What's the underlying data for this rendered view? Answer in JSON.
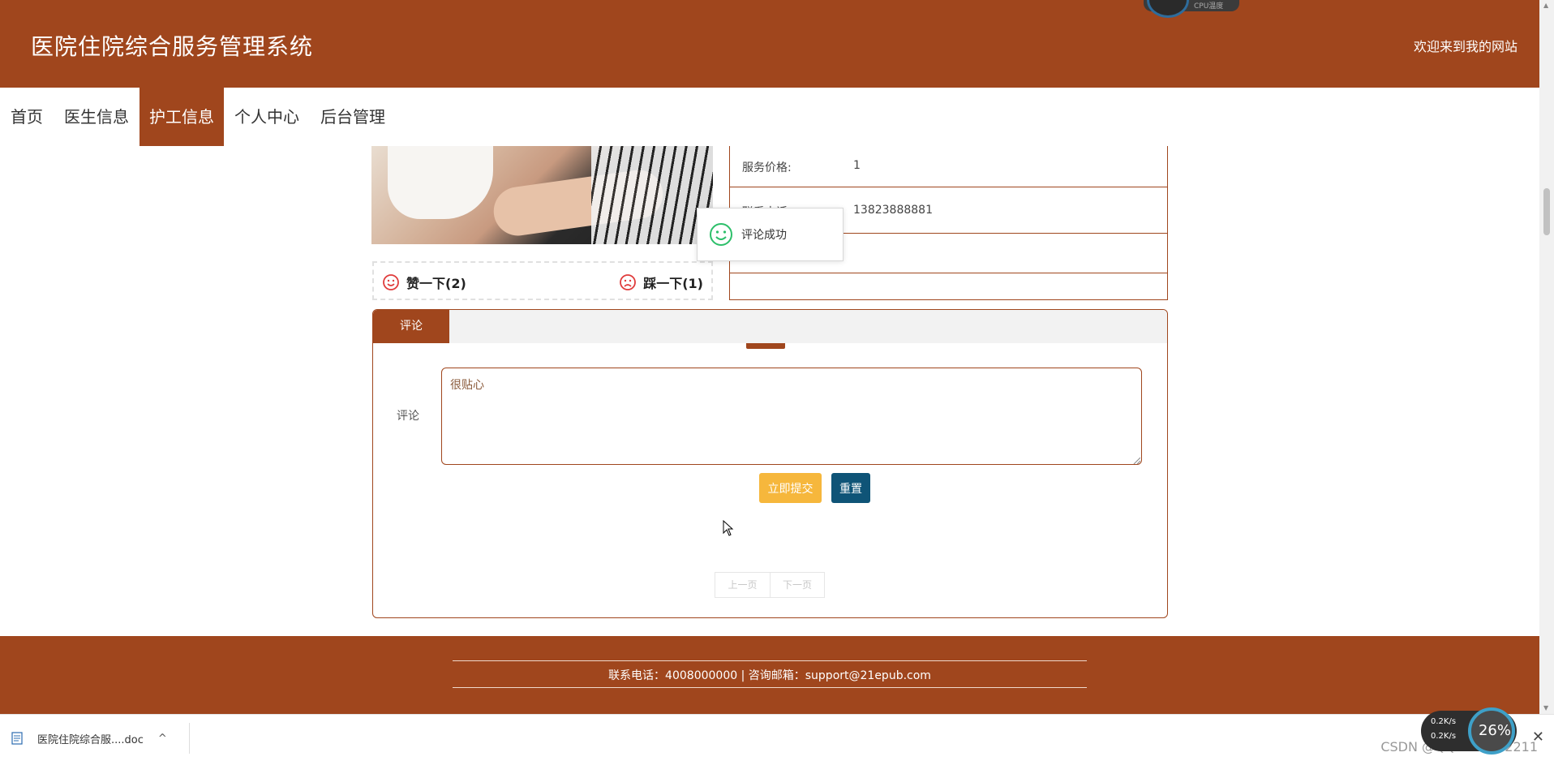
{
  "header": {
    "site_title": "医院住院综合服务管理系统",
    "welcome": "欢迎来到我的网站"
  },
  "nav": {
    "items": [
      {
        "label": "首页"
      },
      {
        "label": "医生信息"
      },
      {
        "label": "护工信息",
        "active": true
      },
      {
        "label": "个人中心"
      },
      {
        "label": "后台管理"
      }
    ]
  },
  "vote": {
    "like_label": "赞一下(2)",
    "dislike_label": "踩一下(1)"
  },
  "info": {
    "rows": [
      {
        "label": "服务价格:",
        "value": "1"
      },
      {
        "label": "联系电话:",
        "value": "13823888881"
      }
    ]
  },
  "toast": {
    "message": "评论成功",
    "icon": "smile-icon"
  },
  "comment": {
    "tab_label": "评论",
    "field_label": "评论",
    "input_value": "很贴心",
    "submit_label": "立即提交",
    "reset_label": "重置"
  },
  "pager": {
    "prev_label": "上一页",
    "next_label": "下一页"
  },
  "footer": {
    "contact": "联系电话：4008000000 | 咨询邮箱：support@21epub.com"
  },
  "download_bar": {
    "file_name": "医院住院综合服....doc",
    "watermark": "CSDN @QQ1039692211"
  },
  "widgets": {
    "cpu_label": "CPU温度",
    "net_up": "0.2K/s",
    "net_down": "0.2K/s",
    "usage_percent": "26%"
  },
  "colors": {
    "brand": "#a0461d",
    "submit": "#f6b73c",
    "reset": "#0f5477",
    "toast_icon": "#2dbf6a",
    "vote_icon": "#e03c3c"
  }
}
